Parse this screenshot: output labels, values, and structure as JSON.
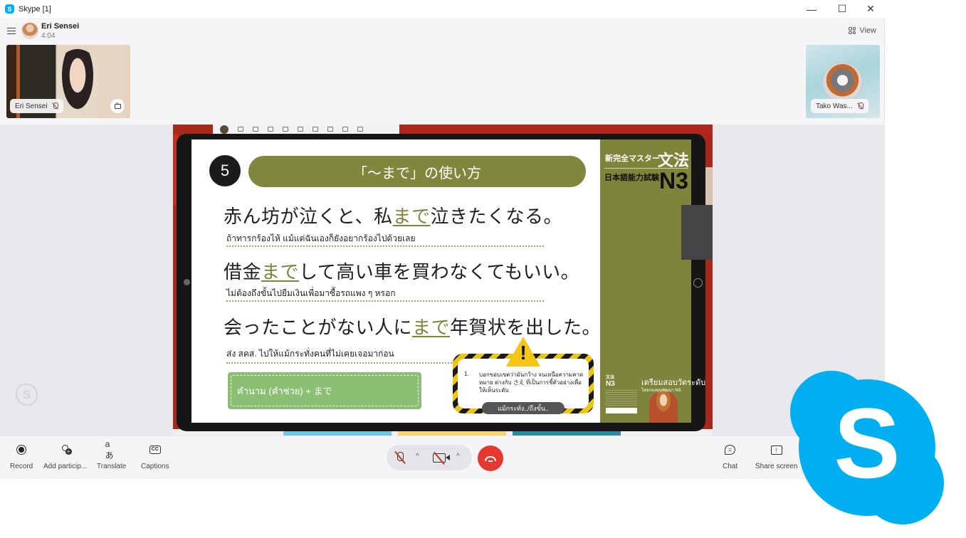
{
  "window": {
    "title": "Skype [1]",
    "controls": {
      "minimize": "—",
      "maximize": "☐",
      "close": "✕"
    }
  },
  "header": {
    "caller_name": "Eri Sensei",
    "call_duration": "4:04",
    "view_label": "View"
  },
  "participants": [
    {
      "name": "Eri Sensei",
      "muted": true
    },
    {
      "name": "Tako Was...",
      "muted": true
    }
  ],
  "slide": {
    "number": "5",
    "title": "「～まで」の使い方",
    "sentences": [
      {
        "pre": "赤ん坊が泣くと、私",
        "highlight": "まで",
        "post": "泣きたくなる。",
        "translation": "ถ้าทารกร้องไห้ แม้แต่ฉันเองก็ยังอยากร้องไปด้วยเลย"
      },
      {
        "pre": "借金",
        "highlight": "まで",
        "post": "して高い車を買わなくてもいい。",
        "translation": "ไม่ต้องถึงขั้นไปยืมเงินเพื่อมาซื้อรถแพง ๆ หรอก"
      },
      {
        "pre": "会ったことがない人に",
        "highlight": "まで",
        "post": "年賀状を出した。",
        "translation": "ส่ง สคส. ไปให้แม้กระทั่งคนที่ไม่เคยเจอมาก่อน"
      }
    ],
    "formula": "คำนาม (คำช่วย) + まで",
    "warning": {
      "index": "1.",
      "text": "บอกขอบเขตว่ามันกว้าง จนเหนือความคาดหมาย ต่างกับ さえ ที่เป็นการชี้ตัวอย่างเพื่อให้เห็นระดับ",
      "pill": "แม้กระทั่ง../ถึงขั้น.."
    },
    "book": {
      "series": "新完全マスター",
      "subject": "文法",
      "exam": "日本語能力試験",
      "level": "N3",
      "promo_title": "เตรียมสอบวัดระดับ",
      "promo_sub": "โดยกองทุนพัฒนา NS"
    }
  },
  "controls": {
    "left": [
      {
        "id": "record",
        "label": "Record"
      },
      {
        "id": "add",
        "label": "Add particip..."
      },
      {
        "id": "translate",
        "label": "Translate",
        "glyph": "aあ"
      },
      {
        "id": "captions",
        "label": "Captions",
        "glyph": "CC"
      }
    ],
    "right": [
      {
        "id": "chat",
        "label": "Chat"
      },
      {
        "id": "share",
        "label": "Share screen"
      }
    ],
    "chevron": "^"
  },
  "colors": {
    "skype_blue": "#00aff0",
    "hangup_red": "#e5392f",
    "slide_olive": "#80863b"
  }
}
